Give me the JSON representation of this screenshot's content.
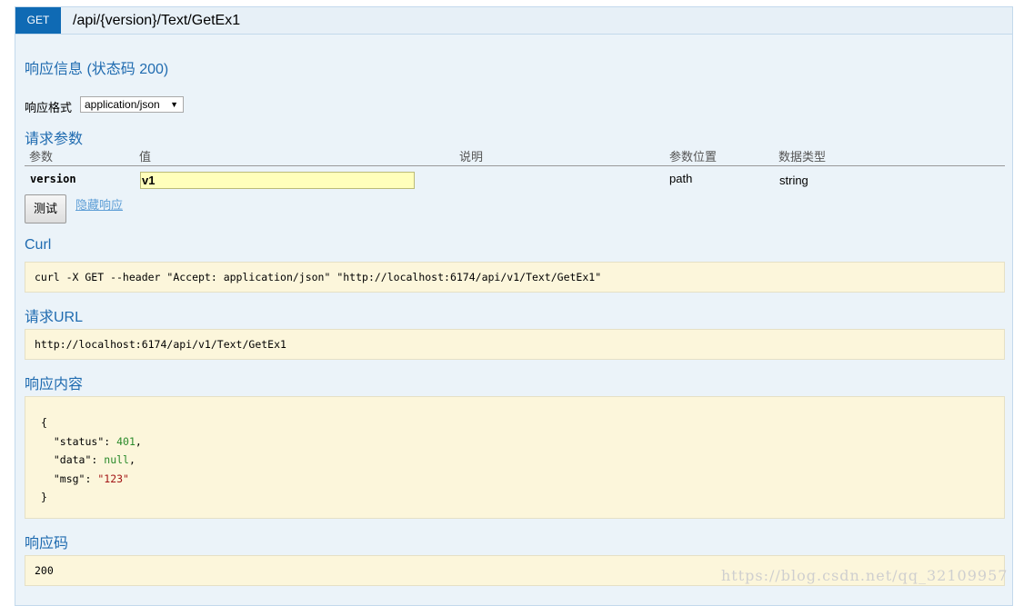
{
  "operation": {
    "method": "GET",
    "path": "/api/{version}/Text/GetEx1"
  },
  "response_info": {
    "title": "响应信息 (状态码 200)",
    "format_label": "响应格式",
    "format_value": "application/json"
  },
  "parameters": {
    "title": "请求参数",
    "headers": [
      "参数",
      "值",
      "说明",
      "参数位置",
      "数据类型"
    ],
    "rows": [
      {
        "name": "version",
        "value": "v1",
        "description": "",
        "location": "path",
        "type": "string"
      }
    ]
  },
  "actions": {
    "try_button": "测试",
    "hide_response": "隐藏响应"
  },
  "curl": {
    "title": "Curl",
    "command": "curl -X GET --header \"Accept: application/json\" \"http://localhost:6174/api/v1/Text/GetEx1\""
  },
  "request_url": {
    "title": "请求URL",
    "url": "http://localhost:6174/api/v1/Text/GetEx1"
  },
  "response_body": {
    "title": "响应内容",
    "open": "{",
    "close": "}",
    "fields": [
      {
        "key": "\"status\"",
        "value": "401",
        "kind": "number",
        "suffix": ","
      },
      {
        "key": "\"data\"",
        "value": "null",
        "kind": "null",
        "suffix": ","
      },
      {
        "key": "\"msg\"",
        "value": "\"123\"",
        "kind": "string",
        "suffix": ""
      }
    ]
  },
  "response_code": {
    "title": "响应码",
    "code": "200"
  },
  "watermark": "https://blog.csdn.net/qq_32109957"
}
